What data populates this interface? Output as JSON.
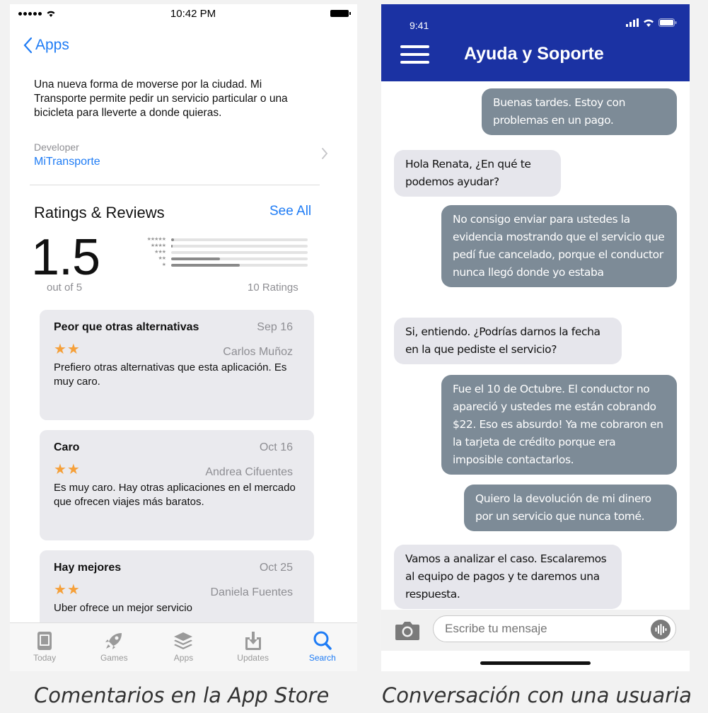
{
  "app_store": {
    "status_time": "10:42 PM",
    "back_label": "Apps",
    "description": "Una nueva forma de moverse por la ciudad. Mi Transporte permite pedir un servicio particular o una bicicleta para lleverte a donde quieras.",
    "developer_label": "Developer",
    "developer_name": "MiTransporte",
    "ratings_title": "Ratings & Reviews",
    "see_all": "See All",
    "rating_value": "1.5",
    "out_of": "out of 5",
    "num_ratings": "10 Ratings",
    "histogram": [
      {
        "stars": "★★★★★",
        "fraction": 0.02
      },
      {
        "stars": "★★★★",
        "fraction": 0.01
      },
      {
        "stars": "★★★",
        "fraction": 0.0
      },
      {
        "stars": "★★",
        "fraction": 0.36
      },
      {
        "stars": "★",
        "fraction": 0.5
      }
    ],
    "reviews": [
      {
        "title": "Peor que otras alternativas",
        "date": "Sep 16",
        "stars": "★★",
        "author": "Carlos Muñoz",
        "body": "Prefiero otras alternativas que esta aplicación. Es muy caro."
      },
      {
        "title": "Caro",
        "date": "Oct 16",
        "stars": "★★",
        "author": "Andrea Cifuentes",
        "body": "Es muy caro. Hay otras aplicaciones en el mercado que ofrecen viajes más baratos."
      },
      {
        "title": "Hay mejores",
        "date": "Oct 25",
        "stars": "★★",
        "author": "Daniela Fuentes",
        "body": "Uber ofrece un mejor servicio"
      }
    ],
    "tabs": [
      {
        "label": "Today",
        "icon": "today-icon",
        "active": false
      },
      {
        "label": "Games",
        "icon": "rocket-icon",
        "active": false
      },
      {
        "label": "Apps",
        "icon": "layers-icon",
        "active": false
      },
      {
        "label": "Updates",
        "icon": "download-icon",
        "active": false
      },
      {
        "label": "Search",
        "icon": "search-icon",
        "active": true
      }
    ],
    "accent_color": "#1f7cf5",
    "star_color": "#f5a03a"
  },
  "chat": {
    "status_time": "9:41",
    "title": "Ayuda y Soporte",
    "header_color": "#1b32a3",
    "messages": [
      {
        "from": "user",
        "text": "Buenas tardes. Estoy con problemas en un pago."
      },
      {
        "from": "support",
        "text": "Hola Renata, ¿En qué te podemos ayudar?"
      },
      {
        "from": "user",
        "text": "No consigo enviar para ustedes la evidencia mostrando que el servicio que pedí fue cancelado, porque el conductor nunca llegó donde yo estaba"
      },
      {
        "from": "support",
        "text": "Si, entiendo. ¿Podrías darnos la fecha en la que pediste el servicio?"
      },
      {
        "from": "user",
        "text": "Fue el 10 de Octubre. El conductor no apareció y ustedes me están cobrando $22. Eso es absurdo! Ya me cobraron en la tarjeta de crédito porque era imposible contactarlos."
      },
      {
        "from": "user",
        "text": "Quiero la devolución de mi dinero por un servicio que nunca tomé."
      },
      {
        "from": "support",
        "text": "Vamos a analizar el caso. Escalaremos al equipo de pagos y te daremos una respuesta."
      }
    ],
    "input_placeholder": "Escribe tu mensaje"
  },
  "captions": {
    "left": "Comentarios en la App Store",
    "right": "Conversación con una usuaria"
  }
}
